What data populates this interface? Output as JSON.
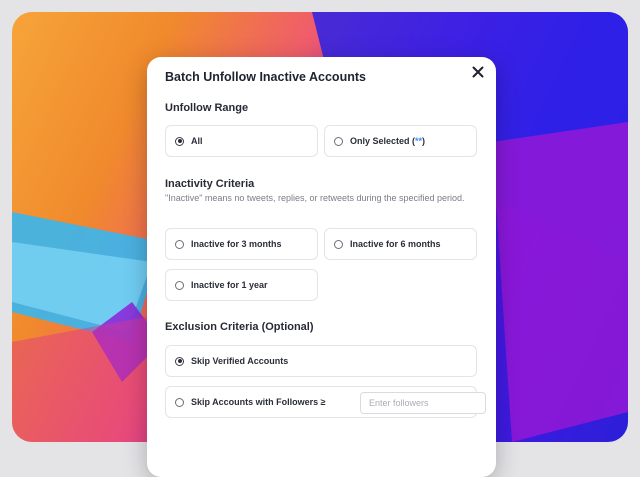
{
  "modal": {
    "title": "Batch Unfollow Inactive Accounts",
    "close_icon": "close-icon"
  },
  "unfollow_range": {
    "label": "Unfollow Range",
    "options": [
      {
        "label": "All",
        "selected": true
      },
      {
        "label_prefix": "Only Selected (",
        "label_count": "**",
        "label_suffix": ")",
        "selected": false
      }
    ]
  },
  "inactivity": {
    "label": "Inactivity Criteria",
    "hint": "\"Inactive\" means no tweets, replies, or retweets during the specified period.",
    "options": [
      {
        "label": "Inactive for 3 months",
        "selected": false
      },
      {
        "label": "Inactive for 6 months",
        "selected": false
      },
      {
        "label": "Inactive for 1 year",
        "selected": false
      }
    ]
  },
  "exclusion": {
    "label": "Exclusion Criteria (Optional)",
    "options": [
      {
        "label": "Skip Verified Accounts",
        "selected": true
      },
      {
        "label": "Skip Accounts with Followers ≥",
        "selected": false
      }
    ],
    "followers_input": {
      "value": "",
      "placeholder": "Enter followers"
    }
  },
  "colors": {
    "accent": "#3b8ef0",
    "background_gradient": [
      "#f6a43a",
      "#ef5c6c",
      "#b21bd2",
      "#2b1fd8"
    ]
  }
}
